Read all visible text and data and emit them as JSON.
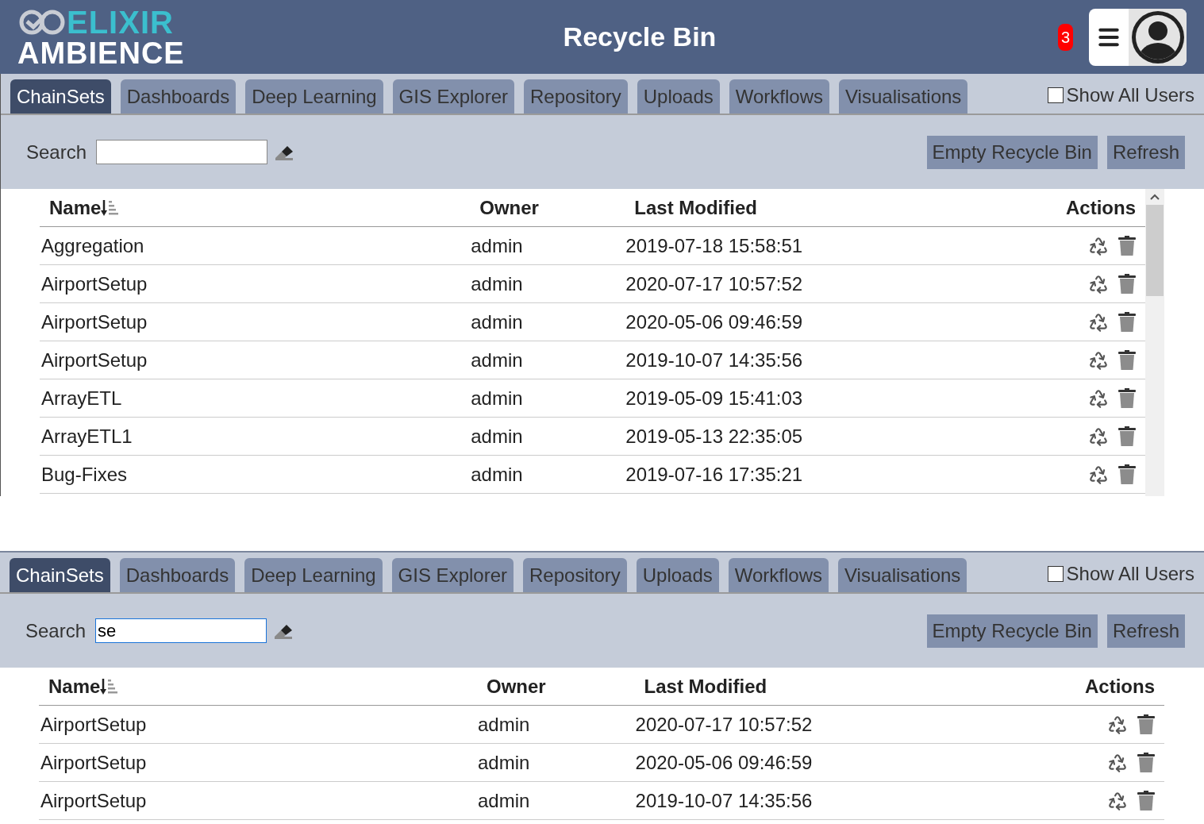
{
  "header": {
    "logo_top": "ELIXIR",
    "logo_bottom": "AMBIENCE",
    "title": "Recycle Bin",
    "notification_count": "3"
  },
  "panels": [
    {
      "tabs": [
        {
          "label": "ChainSets",
          "selected": true
        },
        {
          "label": "Dashboards",
          "selected": false
        },
        {
          "label": "Deep Learning",
          "selected": false
        },
        {
          "label": "GIS Explorer",
          "selected": false
        },
        {
          "label": "Repository",
          "selected": false
        },
        {
          "label": "Uploads",
          "selected": false
        },
        {
          "label": "Workflows",
          "selected": false
        },
        {
          "label": "Visualisations",
          "selected": false
        }
      ],
      "show_all_users": {
        "label": "Show All Users",
        "checked": false
      },
      "search": {
        "label": "Search",
        "focused": false
      },
      "buttons": [
        "Empty Recycle Bin",
        "Refresh"
      ],
      "scrollbar": true,
      "table": {
        "columns": [
          "Name",
          "Owner",
          "Last Modified",
          "Actions"
        ],
        "rows": [
          {
            "name": "Aggregation",
            "owner": "admin",
            "modified": "2019-07-18 15:58:51"
          },
          {
            "name": "AirportSetup",
            "owner": "admin",
            "modified": "2020-07-17 10:57:52"
          },
          {
            "name": "AirportSetup",
            "owner": "admin",
            "modified": "2020-05-06 09:46:59"
          },
          {
            "name": "AirportSetup",
            "owner": "admin",
            "modified": "2019-10-07 14:35:56"
          },
          {
            "name": "ArrayETL",
            "owner": "admin",
            "modified": "2019-05-09 15:41:03"
          },
          {
            "name": "ArrayETL1",
            "owner": "admin",
            "modified": "2019-05-13 22:35:05"
          },
          {
            "name": "Bug-Fixes",
            "owner": "admin",
            "modified": "2019-07-16 17:35:21"
          }
        ]
      }
    },
    {
      "tabs": [
        {
          "label": "ChainSets",
          "selected": true
        },
        {
          "label": "Dashboards",
          "selected": false
        },
        {
          "label": "Deep Learning",
          "selected": false
        },
        {
          "label": "GIS Explorer",
          "selected": false
        },
        {
          "label": "Repository",
          "selected": false
        },
        {
          "label": "Uploads",
          "selected": false
        },
        {
          "label": "Workflows",
          "selected": false
        },
        {
          "label": "Visualisations",
          "selected": false
        }
      ],
      "show_all_users": {
        "label": "Show All Users",
        "checked": false
      },
      "search": {
        "label": "Search",
        "value": "se",
        "focused": true
      },
      "buttons": [
        "Empty Recycle Bin",
        "Refresh"
      ],
      "scrollbar": false,
      "table": {
        "columns": [
          "Name",
          "Owner",
          "Last Modified",
          "Actions"
        ],
        "rows": [
          {
            "name": "AirportSetup",
            "owner": "admin",
            "modified": "2020-07-17 10:57:52"
          },
          {
            "name": "AirportSetup",
            "owner": "admin",
            "modified": "2020-05-06 09:46:59"
          },
          {
            "name": "AirportSetup",
            "owner": "admin",
            "modified": "2019-10-07 14:35:56"
          }
        ]
      }
    }
  ]
}
